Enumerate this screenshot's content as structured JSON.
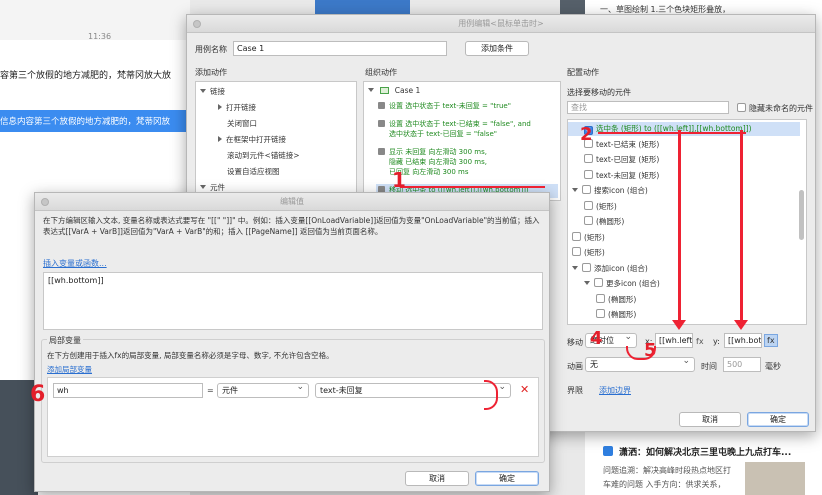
{
  "bg_left": {
    "time": "11:36",
    "line1": "容第三个放假的地方减肥的，梵蒂冈放大放",
    "line2": "信息内容第三个放假的地方减肥的，梵蒂冈放"
  },
  "bg_right": {
    "top_text": "一、草图绘制 1.三个色块矩形叠放，",
    "news_title": "潇洒：如何解决北京三里屯晚上九点打车...",
    "news_body1": "问题追溯：解决高峰时段热点地区打",
    "news_body2": "车难的问题 入手方向：供求关系，"
  },
  "case_editor": {
    "title": "用例编辑<鼠标单击时>",
    "case_name_label": "用例名称",
    "case_name_value": "Case 1",
    "add_condition_btn": "添加条件",
    "add_action_header": "添加动作",
    "organize_header": "组织动作",
    "config_header": "配置动作",
    "add_actions": [
      {
        "label": "链接",
        "level": 0,
        "arrow": "down"
      },
      {
        "label": "打开链接",
        "level": 1,
        "arrow": "right"
      },
      {
        "label": "关闭窗口",
        "level": 1,
        "arrow": ""
      },
      {
        "label": "在框架中打开链接",
        "level": 1,
        "arrow": "right"
      },
      {
        "label": "滚动到元件<锚链接>",
        "level": 1,
        "arrow": ""
      },
      {
        "label": "设置自适应视图",
        "level": 1,
        "arrow": ""
      },
      {
        "label": "元件",
        "level": 0,
        "arrow": "down"
      }
    ],
    "organize": {
      "case_label": "Case 1",
      "actions": [
        {
          "lines": [
            "设置 选中状态于 text-未回复 = \"true\""
          ]
        },
        {
          "lines": [
            "设置 选中状态于 text-已结束 = \"false\", and",
            "选中状态于 text-已回复 = \"false\""
          ]
        },
        {
          "lines": [
            "显示 未回复 向左滑动 300 ms,",
            "隐藏 已结束 向左滑动 300 ms,",
            "已回复 向左滑动 300 ms"
          ]
        },
        {
          "lines": [
            "移动 选中条 to ([[wh.left]],[[wh.bottom]])"
          ]
        }
      ]
    },
    "config": {
      "choose_label": "选择要移动的元件",
      "search_placeholder": "查找",
      "hide_unnamed_label": "隐藏未命名的元件",
      "tree": [
        {
          "label": "选中条 (矩形) to ([[wh.left]],[[wh.bottom]])",
          "indent": 1,
          "checked": true,
          "arrow": "",
          "selected": true
        },
        {
          "label": "text-已结束 (矩形)",
          "indent": 1,
          "checked": false,
          "arrow": ""
        },
        {
          "label": "text-已回复 (矩形)",
          "indent": 1,
          "checked": false,
          "arrow": ""
        },
        {
          "label": "text-未回复 (矩形)",
          "indent": 1,
          "checked": false,
          "arrow": ""
        },
        {
          "label": "搜索icon (组合)",
          "indent": 0,
          "checked": false,
          "arrow": "down"
        },
        {
          "label": "(矩形)",
          "indent": 1,
          "checked": false,
          "arrow": ""
        },
        {
          "label": "(椭圆形)",
          "indent": 1,
          "checked": false,
          "arrow": ""
        },
        {
          "label": "(矩形)",
          "indent": 0,
          "checked": false,
          "arrow": ""
        },
        {
          "label": "(矩形)",
          "indent": 0,
          "checked": false,
          "arrow": ""
        },
        {
          "label": "添加icon (组合)",
          "indent": 0,
          "checked": false,
          "arrow": "down"
        },
        {
          "label": "更多icon (组合)",
          "indent": 1,
          "checked": false,
          "arrow": "down"
        },
        {
          "label": "(椭圆形)",
          "indent": 2,
          "checked": false,
          "arrow": ""
        },
        {
          "label": "(椭圆形)",
          "indent": 2,
          "checked": false,
          "arrow": ""
        }
      ],
      "move_label": "移动",
      "move_mode": "绝对位",
      "x_label": "x:",
      "x_value": "[[wh.left]]",
      "y_label": "y:",
      "y_value": "[[wh.bottom]]",
      "fx": "fx",
      "anim_label": "动画",
      "anim_value": "无",
      "time_label": "时间",
      "time_value": "500",
      "ms_label": "毫秒",
      "bounds_label": "界限",
      "add_bounds_link": "添加边界"
    },
    "cancel_btn": "取消",
    "ok_btn": "确定"
  },
  "value_editor": {
    "title": "编辑值",
    "desc": "在下方编辑区输入文本, 变量名称或表达式要写在 \"[[\" \"]]\" 中。例如：插入变量[[OnLoadVariable]]返回值为变量\"OnLoadVariable\"的当前值；插入表达式[[VarA + VarB]]返回值为\"VarA + VarB\"的和；插入 [[PageName]] 返回值为当前页面名称。",
    "insert_link": "插入变量或函数...",
    "editor_value": "[[wh.bottom]]",
    "local_vars_header": "局部变量",
    "local_vars_desc": "在下方创建用于插入fx的局部变量, 局部变量名称必须是字母、数字, 不允许包含空格。",
    "add_local_link": "添加局部变量",
    "var_name": "wh",
    "eq": "=",
    "var_type": "元件",
    "var_target": "text-未回复",
    "cancel_btn": "取消",
    "ok_btn": "确定"
  },
  "annotations": {
    "n1": "1",
    "n2": "2",
    "n4": "4",
    "n5": "5",
    "n6": "6",
    "color": "#ee2233"
  }
}
